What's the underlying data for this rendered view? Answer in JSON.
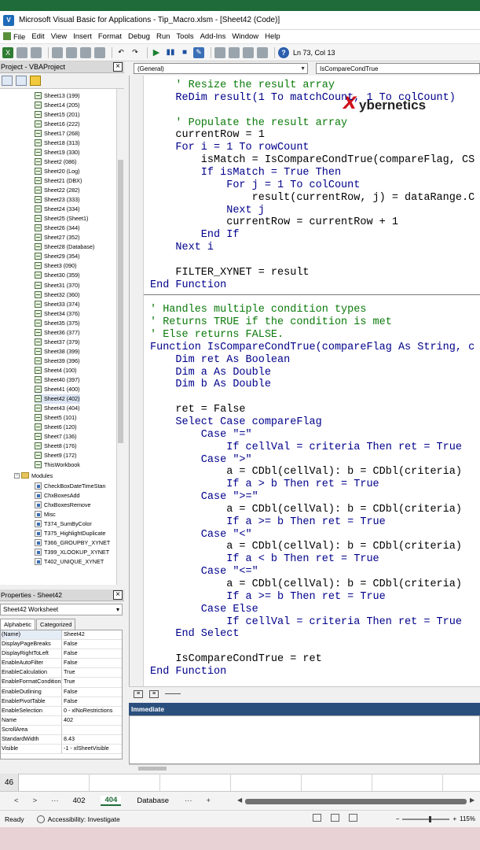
{
  "window": {
    "title": "Microsoft Visual Basic for Applications - Tip_Macro.xlsm - [Sheet42 (Code)]"
  },
  "menu": [
    "File",
    "Edit",
    "View",
    "Insert",
    "Format",
    "Debug",
    "Run",
    "Tools",
    "Add-Ins",
    "Window",
    "Help"
  ],
  "toolbar": {
    "cursor_position": "Ln 73, Col 13"
  },
  "project": {
    "title": "Project - VBAProject",
    "items": [
      {
        "label": "Sheet13 (199)"
      },
      {
        "label": "Sheet14 (205)"
      },
      {
        "label": "Sheet15 (201)"
      },
      {
        "label": "Sheet16 (222)"
      },
      {
        "label": "Sheet17 (268)"
      },
      {
        "label": "Sheet18 (313)"
      },
      {
        "label": "Sheet19 (330)"
      },
      {
        "label": "Sheet2 (086)"
      },
      {
        "label": "Sheet20 (Log)"
      },
      {
        "label": "Sheet21 (DBX)"
      },
      {
        "label": "Sheet22 (282)"
      },
      {
        "label": "Sheet23 (333)"
      },
      {
        "label": "Sheet24 (334)"
      },
      {
        "label": "Sheet25 (Sheet1)"
      },
      {
        "label": "Sheet26 (344)"
      },
      {
        "label": "Sheet27 (352)"
      },
      {
        "label": "Sheet28 (Database)"
      },
      {
        "label": "Sheet29 (354)"
      },
      {
        "label": "Sheet3 (090)"
      },
      {
        "label": "Sheet30 (359)"
      },
      {
        "label": "Sheet31 (370)"
      },
      {
        "label": "Sheet32 (360)"
      },
      {
        "label": "Sheet33 (374)"
      },
      {
        "label": "Sheet34 (376)"
      },
      {
        "label": "Sheet35 (375)"
      },
      {
        "label": "Sheet36 (377)"
      },
      {
        "label": "Sheet37 (379)"
      },
      {
        "label": "Sheet38 (399)"
      },
      {
        "label": "Sheet39 (396)"
      },
      {
        "label": "Sheet4 (100)"
      },
      {
        "label": "Sheet40 (397)"
      },
      {
        "label": "Sheet41 (400)"
      },
      {
        "label": "Sheet42 (402)"
      },
      {
        "label": "Sheet43 (404)"
      },
      {
        "label": "Sheet5 (101)"
      },
      {
        "label": "Sheet6 (120)"
      },
      {
        "label": "Sheet7 (136)"
      },
      {
        "label": "Sheet8 (176)"
      },
      {
        "label": "Sheet9 (172)"
      },
      {
        "label": "ThisWorkbook"
      }
    ],
    "modules_label": "Modules",
    "modules": [
      {
        "label": "CheckBoxDateTimeStan"
      },
      {
        "label": "ChxBoxesAdd"
      },
      {
        "label": "ChxBoxesRemove"
      },
      {
        "label": "Misc"
      },
      {
        "label": "T374_SumByColor"
      },
      {
        "label": "T375_HighlightDuplicate"
      },
      {
        "label": "T366_GROUPBY_XYNET"
      },
      {
        "label": "T399_XLOOKUP_XYNET"
      },
      {
        "label": "T402_UNIQUE_XYNET"
      }
    ]
  },
  "properties": {
    "title": "Properties - Sheet42",
    "object": "Sheet42 Worksheet",
    "tabs": [
      "Alphabetic",
      "Categorized"
    ],
    "rows": [
      {
        "k": "(Name)",
        "v": "Sheet42"
      },
      {
        "k": "DisplayPageBreaks",
        "v": "False"
      },
      {
        "k": "DisplayRightToLeft",
        "v": "False"
      },
      {
        "k": "EnableAutoFilter",
        "v": "False"
      },
      {
        "k": "EnableCalculation",
        "v": "True"
      },
      {
        "k": "EnableFormatConditionsCalculation",
        "v": "True"
      },
      {
        "k": "EnableOutlining",
        "v": "False"
      },
      {
        "k": "EnablePivotTable",
        "v": "False"
      },
      {
        "k": "EnableSelection",
        "v": "0 - xlNoRestrictions"
      },
      {
        "k": "Name",
        "v": "402"
      },
      {
        "k": "ScrollArea",
        "v": ""
      },
      {
        "k": "StandardWidth",
        "v": "8.43"
      },
      {
        "k": "Visible",
        "v": "-1 - xlSheetVisible"
      }
    ]
  },
  "code": {
    "object_combo": "(General)",
    "proc_combo": "IsCompareCondTrue",
    "watermark_x": "x",
    "watermark_text": "ybernetics",
    "lines": [
      {
        "t": "    ' Resize the result array",
        "c": "cm"
      },
      {
        "t": "    ReDim result(1 To matchCount, 1 To colCount)",
        "c": "kw"
      },
      {
        "t": "",
        "c": ""
      },
      {
        "t": "    ' Populate the result array",
        "c": "cm"
      },
      {
        "t": "    currentRow = 1",
        "c": ""
      },
      {
        "t": "    For i = 1 To rowCount",
        "c": "kw"
      },
      {
        "t": "        isMatch = IsCompareCondTrue(compareFlag, CS",
        "c": ""
      },
      {
        "t": "        If isMatch = True Then",
        "c": "kw"
      },
      {
        "t": "            For j = 1 To colCount",
        "c": "kw"
      },
      {
        "t": "                result(currentRow, j) = dataRange.C",
        "c": ""
      },
      {
        "t": "            Next j",
        "c": "kw"
      },
      {
        "t": "            currentRow = currentRow + 1",
        "c": ""
      },
      {
        "t": "        End If",
        "c": "kw"
      },
      {
        "t": "    Next i",
        "c": "kw"
      },
      {
        "t": "",
        "c": ""
      },
      {
        "t": "    FILTER_XYNET = result",
        "c": ""
      },
      {
        "t": "End Function",
        "c": "kw"
      },
      {
        "t": "",
        "c": ""
      },
      {
        "t": "' Handles multiple condition types",
        "c": "cm"
      },
      {
        "t": "' Returns TRUE if the condition is met",
        "c": "cm"
      },
      {
        "t": "' Else returns FALSE.",
        "c": "cm"
      },
      {
        "t": "Function IsCompareCondTrue(compareFlag As String, c",
        "c": "kw"
      },
      {
        "t": "    Dim ret As Boolean",
        "c": "kw"
      },
      {
        "t": "    Dim a As Double",
        "c": "kw"
      },
      {
        "t": "    Dim b As Double",
        "c": "kw"
      },
      {
        "t": "",
        "c": ""
      },
      {
        "t": "    ret = False",
        "c": ""
      },
      {
        "t": "    Select Case compareFlag",
        "c": "kw"
      },
      {
        "t": "        Case \"=\"",
        "c": "kw"
      },
      {
        "t": "            If cellVal = criteria Then ret = True",
        "c": "kw"
      },
      {
        "t": "        Case \">\"",
        "c": "kw"
      },
      {
        "t": "            a = CDbl(cellVal): b = CDbl(criteria)",
        "c": ""
      },
      {
        "t": "            If a > b Then ret = True",
        "c": "kw"
      },
      {
        "t": "        Case \">=\"",
        "c": "kw"
      },
      {
        "t": "            a = CDbl(cellVal): b = CDbl(criteria)",
        "c": ""
      },
      {
        "t": "            If a >= b Then ret = True",
        "c": "kw"
      },
      {
        "t": "        Case \"<\"",
        "c": "kw"
      },
      {
        "t": "            a = CDbl(cellVal): b = CDbl(criteria)",
        "c": ""
      },
      {
        "t": "            If a < b Then ret = True",
        "c": "kw"
      },
      {
        "t": "        Case \"<=\"",
        "c": "kw"
      },
      {
        "t": "            a = CDbl(cellVal): b = CDbl(criteria)",
        "c": ""
      },
      {
        "t": "            If a >= b Then ret = True",
        "c": "kw"
      },
      {
        "t": "        Case Else",
        "c": "kw"
      },
      {
        "t": "            If cellVal = criteria Then ret = True",
        "c": "kw"
      },
      {
        "t": "    End Select",
        "c": "kw"
      },
      {
        "t": "",
        "c": ""
      },
      {
        "t": "    IsCompareCondTrue = ret",
        "c": ""
      },
      {
        "t": "End Function",
        "c": "kw"
      }
    ]
  },
  "immediate": {
    "title": "Immediate"
  },
  "excel": {
    "row_number": "46",
    "nav_prev": "<",
    "nav_next": ">",
    "nav_more": "···",
    "tabs": [
      "402",
      "404",
      "Database"
    ],
    "active_tab": "404",
    "more_tabs": "···",
    "add_sheet": "+",
    "status": "Ready",
    "accessibility": "Accessibility: Investigate",
    "zoom": "115%"
  }
}
